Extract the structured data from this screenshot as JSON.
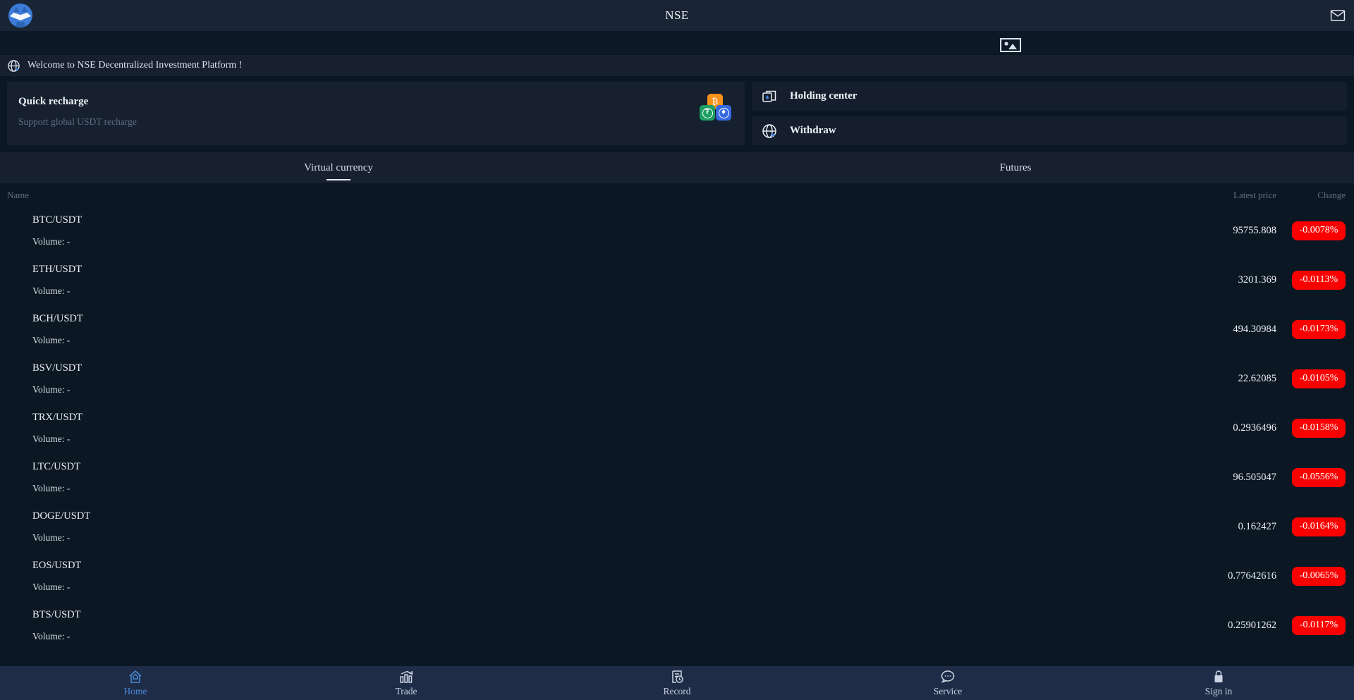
{
  "colors": {
    "badge_red": "#fb0000",
    "accent_blue": "#4a8bd4",
    "coin_btc_orange": "#f7931a",
    "coin_usdt_green": "#1d9e63",
    "coin_eth_blue": "#3668e0"
  },
  "header": {
    "title": "NSE"
  },
  "notice": {
    "text": "Welcome to NSE Decentralized Investment Platform !"
  },
  "quick_recharge": {
    "title": "Quick recharge",
    "subtitle": "Support global USDT recharge",
    "coins": [
      "bitcoin",
      "tether",
      "ethereum"
    ]
  },
  "actions": [
    {
      "label": "Holding center"
    },
    {
      "label": "Withdraw"
    }
  ],
  "tabs": [
    {
      "label": "Virtual currency",
      "active": true
    },
    {
      "label": "Futures",
      "active": false
    }
  ],
  "market_table": {
    "columns": {
      "name": "Name",
      "price": "Latest price",
      "change": "Change"
    },
    "volume_label": "Volume: -",
    "rows": [
      {
        "pair": "BTC/USDT",
        "price": "95755.808",
        "change": "-0.0078%"
      },
      {
        "pair": "ETH/USDT",
        "price": "3201.369",
        "change": "-0.0113%"
      },
      {
        "pair": "BCH/USDT",
        "price": "494.30984",
        "change": "-0.0173%"
      },
      {
        "pair": "BSV/USDT",
        "price": "22.62085",
        "change": "-0.0105%"
      },
      {
        "pair": "TRX/USDT",
        "price": "0.2936496",
        "change": "-0.0158%"
      },
      {
        "pair": "LTC/USDT",
        "price": "96.505047",
        "change": "-0.0556%"
      },
      {
        "pair": "DOGE/USDT",
        "price": "0.162427",
        "change": "-0.0164%"
      },
      {
        "pair": "EOS/USDT",
        "price": "0.77642616",
        "change": "-0.0065%"
      },
      {
        "pair": "BTS/USDT",
        "price": "0.25901262",
        "change": "-0.0117%"
      }
    ]
  },
  "bottom_nav": {
    "items": [
      {
        "label": "Home",
        "active": true
      },
      {
        "label": "Trade",
        "active": false
      },
      {
        "label": "Record",
        "active": false
      },
      {
        "label": "Service",
        "active": false
      },
      {
        "label": "Sign in",
        "active": false
      }
    ]
  },
  "coin_glyphs": {
    "btc": "₿",
    "usdt": "₮",
    "eth": "♦"
  }
}
